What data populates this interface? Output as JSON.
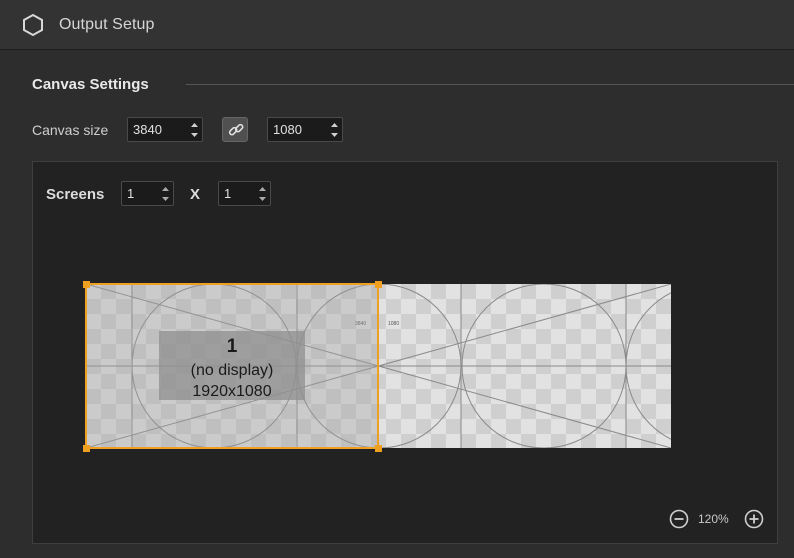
{
  "window": {
    "title": "Output Setup",
    "icon": "hexagon-icon"
  },
  "canvas_settings": {
    "section_title": "Canvas Settings",
    "size_label": "Canvas size",
    "width": "3840",
    "height": "1080",
    "link_icon": "link-icon"
  },
  "screens": {
    "label": "Screens",
    "columns": "1",
    "x_label": "X",
    "rows": "1"
  },
  "preview": {
    "screen_number": "1",
    "screen_status": "(no display)",
    "screen_resolution": "1920x1080",
    "tiny_width_label": "3840",
    "tiny_height_label": "1080",
    "selection_color": "#f0a020"
  },
  "zoom": {
    "level": "120%",
    "minus_icon": "zoom-out-icon",
    "plus_icon": "zoom-in-icon"
  }
}
